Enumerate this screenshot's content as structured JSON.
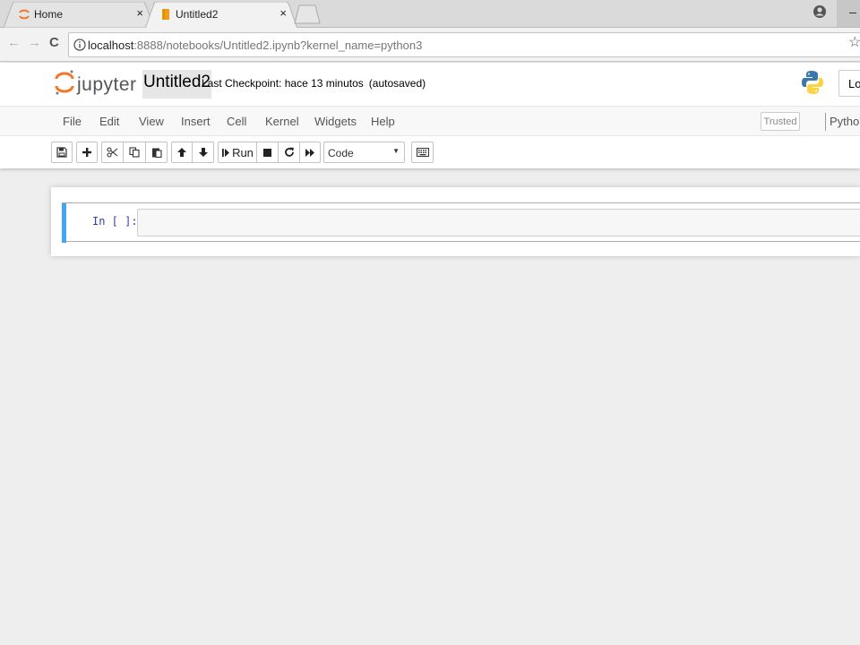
{
  "browser": {
    "tabs": [
      {
        "title": "Home",
        "close": "×"
      },
      {
        "title": "Untitled2",
        "close": "×"
      }
    ],
    "url_host": "localhost",
    "url_path": ":8888/notebooks/Untitled2.ipynb?kernel_name=python3",
    "nav": {
      "back": "←",
      "forward": "→",
      "reload": "C"
    },
    "star": "☆"
  },
  "header": {
    "logo_text": "jupyter",
    "notebook_name": "Untitled2",
    "checkpoint": "Last Checkpoint: hace 13 minutos",
    "autosave": "(autosaved)",
    "logout": "Log"
  },
  "menu": {
    "items": [
      "File",
      "Edit",
      "View",
      "Insert",
      "Cell",
      "Kernel",
      "Widgets",
      "Help"
    ],
    "trusted": "Trusted",
    "kernel": "Python"
  },
  "toolbar": {
    "run_label": "Run",
    "cell_type": "Code",
    "icons": [
      "save-icon",
      "plus-icon",
      "cut-icon",
      "copy-icon",
      "paste-icon",
      "arrow-up-icon",
      "arrow-down-icon",
      "run-icon",
      "stop-icon",
      "restart-icon",
      "fast-forward-icon",
      "keyboard-icon"
    ]
  },
  "cell": {
    "prompt": "In [ ]:",
    "content": ""
  },
  "colors": {
    "accent": "#42a5f5",
    "jupyter_orange": "#f37726",
    "prompt": "#303f9f"
  }
}
